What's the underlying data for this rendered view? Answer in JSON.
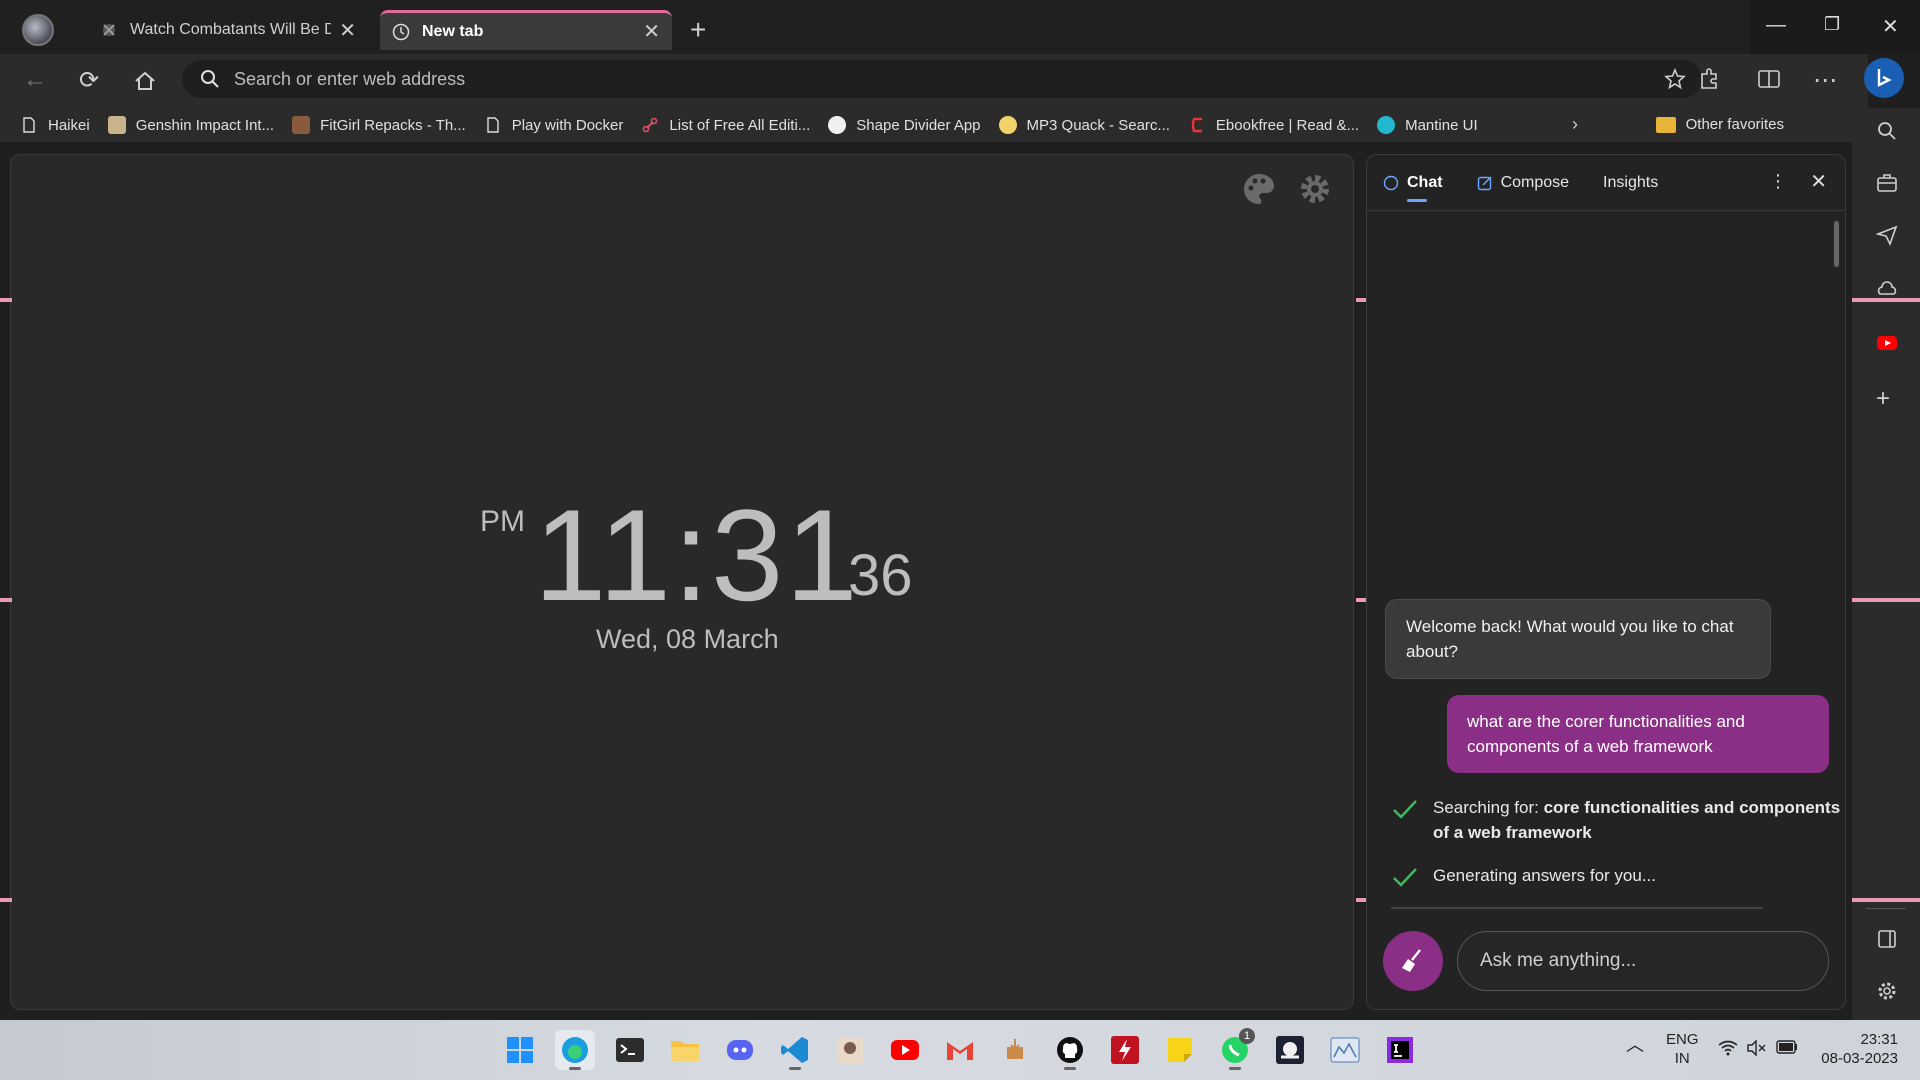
{
  "tabs": [
    {
      "title": "Watch Combatants Will Be Disp",
      "active": false
    },
    {
      "title": "New tab",
      "active": true
    }
  ],
  "address_bar": {
    "placeholder": "Search or enter web address"
  },
  "bookmarks": [
    {
      "label": "Haikei",
      "icon": "page-icon"
    },
    {
      "label": "Genshin Impact Int...",
      "icon": "genshin-icon"
    },
    {
      "label": "FitGirl Repacks - Th...",
      "icon": "fitgirl-icon"
    },
    {
      "label": "Play with Docker",
      "icon": "page-icon"
    },
    {
      "label": "List of Free All Editi...",
      "icon": "link-icon"
    },
    {
      "label": "Shape Divider App",
      "icon": "shape-divider-icon"
    },
    {
      "label": "MP3 Quack - Searc...",
      "icon": "duck-icon"
    },
    {
      "label": "Ebookfree | Read &...",
      "icon": "ebook-icon"
    },
    {
      "label": "Mantine UI",
      "icon": "mantine-icon"
    }
  ],
  "other_favorites": "Other favorites",
  "clock": {
    "ampm": "PM",
    "time": "11:31",
    "seconds": "36",
    "date": "Wed, 08 March"
  },
  "copilot": {
    "tabs": [
      "Chat",
      "Compose",
      "Insights"
    ],
    "bot_message": "Welcome back! What would you like to chat about?",
    "user_message": "what are the corer functionalities and components of a web framework",
    "step1_prefix": "Searching for: ",
    "step1_query": "core functionalities and components of a web framework",
    "step2": "Generating answers for you...",
    "input_placeholder": "Ask me anything..."
  },
  "taskbar": {
    "lang": "ENG",
    "region": "IN",
    "time": "23:31",
    "date": "08-03-2023",
    "whatsapp_badge": "1"
  },
  "colors": {
    "accent_pink": "#e06a9c",
    "copilot_purple": "#8b2f86",
    "check_green": "#3cbf5a"
  }
}
